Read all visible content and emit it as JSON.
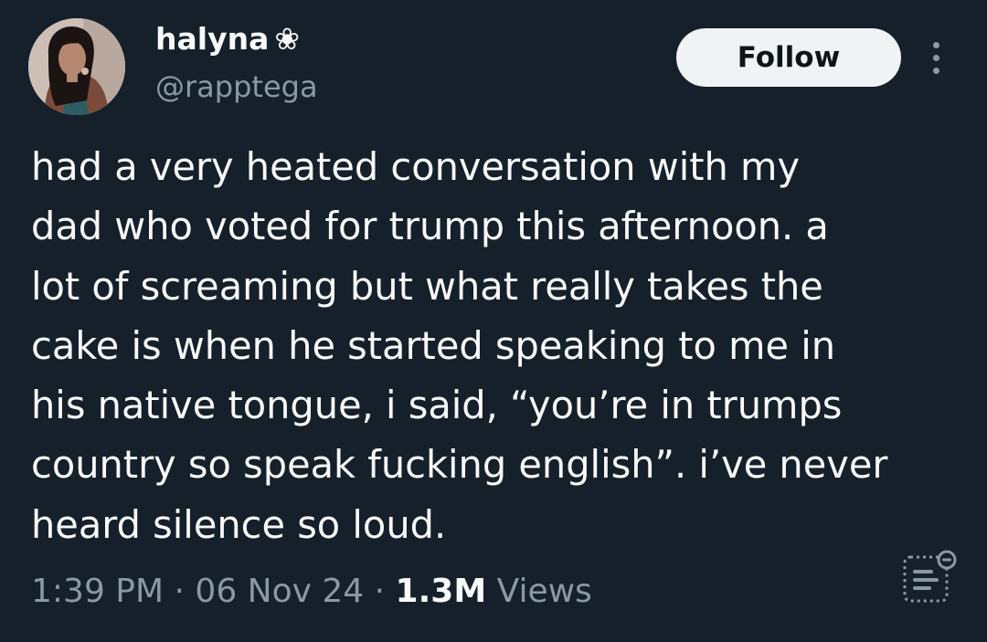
{
  "user": {
    "display_name": "halyna",
    "name_glyph": "❀",
    "handle": "@rapptega",
    "avatar": "profile-photo"
  },
  "actions": {
    "follow_label": "Follow",
    "more_icon": "more-vertical-icon"
  },
  "tweet": {
    "lines": [
      "had a very heated conversation with my",
      "dad who voted for trump this afternoon. a",
      "lot of screaming but what really takes the",
      "cake is when he started speaking to me in",
      "his native tongue, i said, “you’re in trumps",
      "country so speak fucking english”. i’ve never",
      "heard silence so loud."
    ]
  },
  "meta": {
    "time": "1:39 PM",
    "separator": "·",
    "date": "06 Nov 24",
    "views_count": "1.3M",
    "views_label": "Views"
  },
  "icons": {
    "summary_icon": "grok-summary-icon"
  },
  "colors": {
    "background": "#15202b",
    "primary_text": "#f7f9f9",
    "secondary_text": "#8b98a5",
    "follow_button_bg": "#eff3f4",
    "follow_button_text": "#0f1419"
  }
}
